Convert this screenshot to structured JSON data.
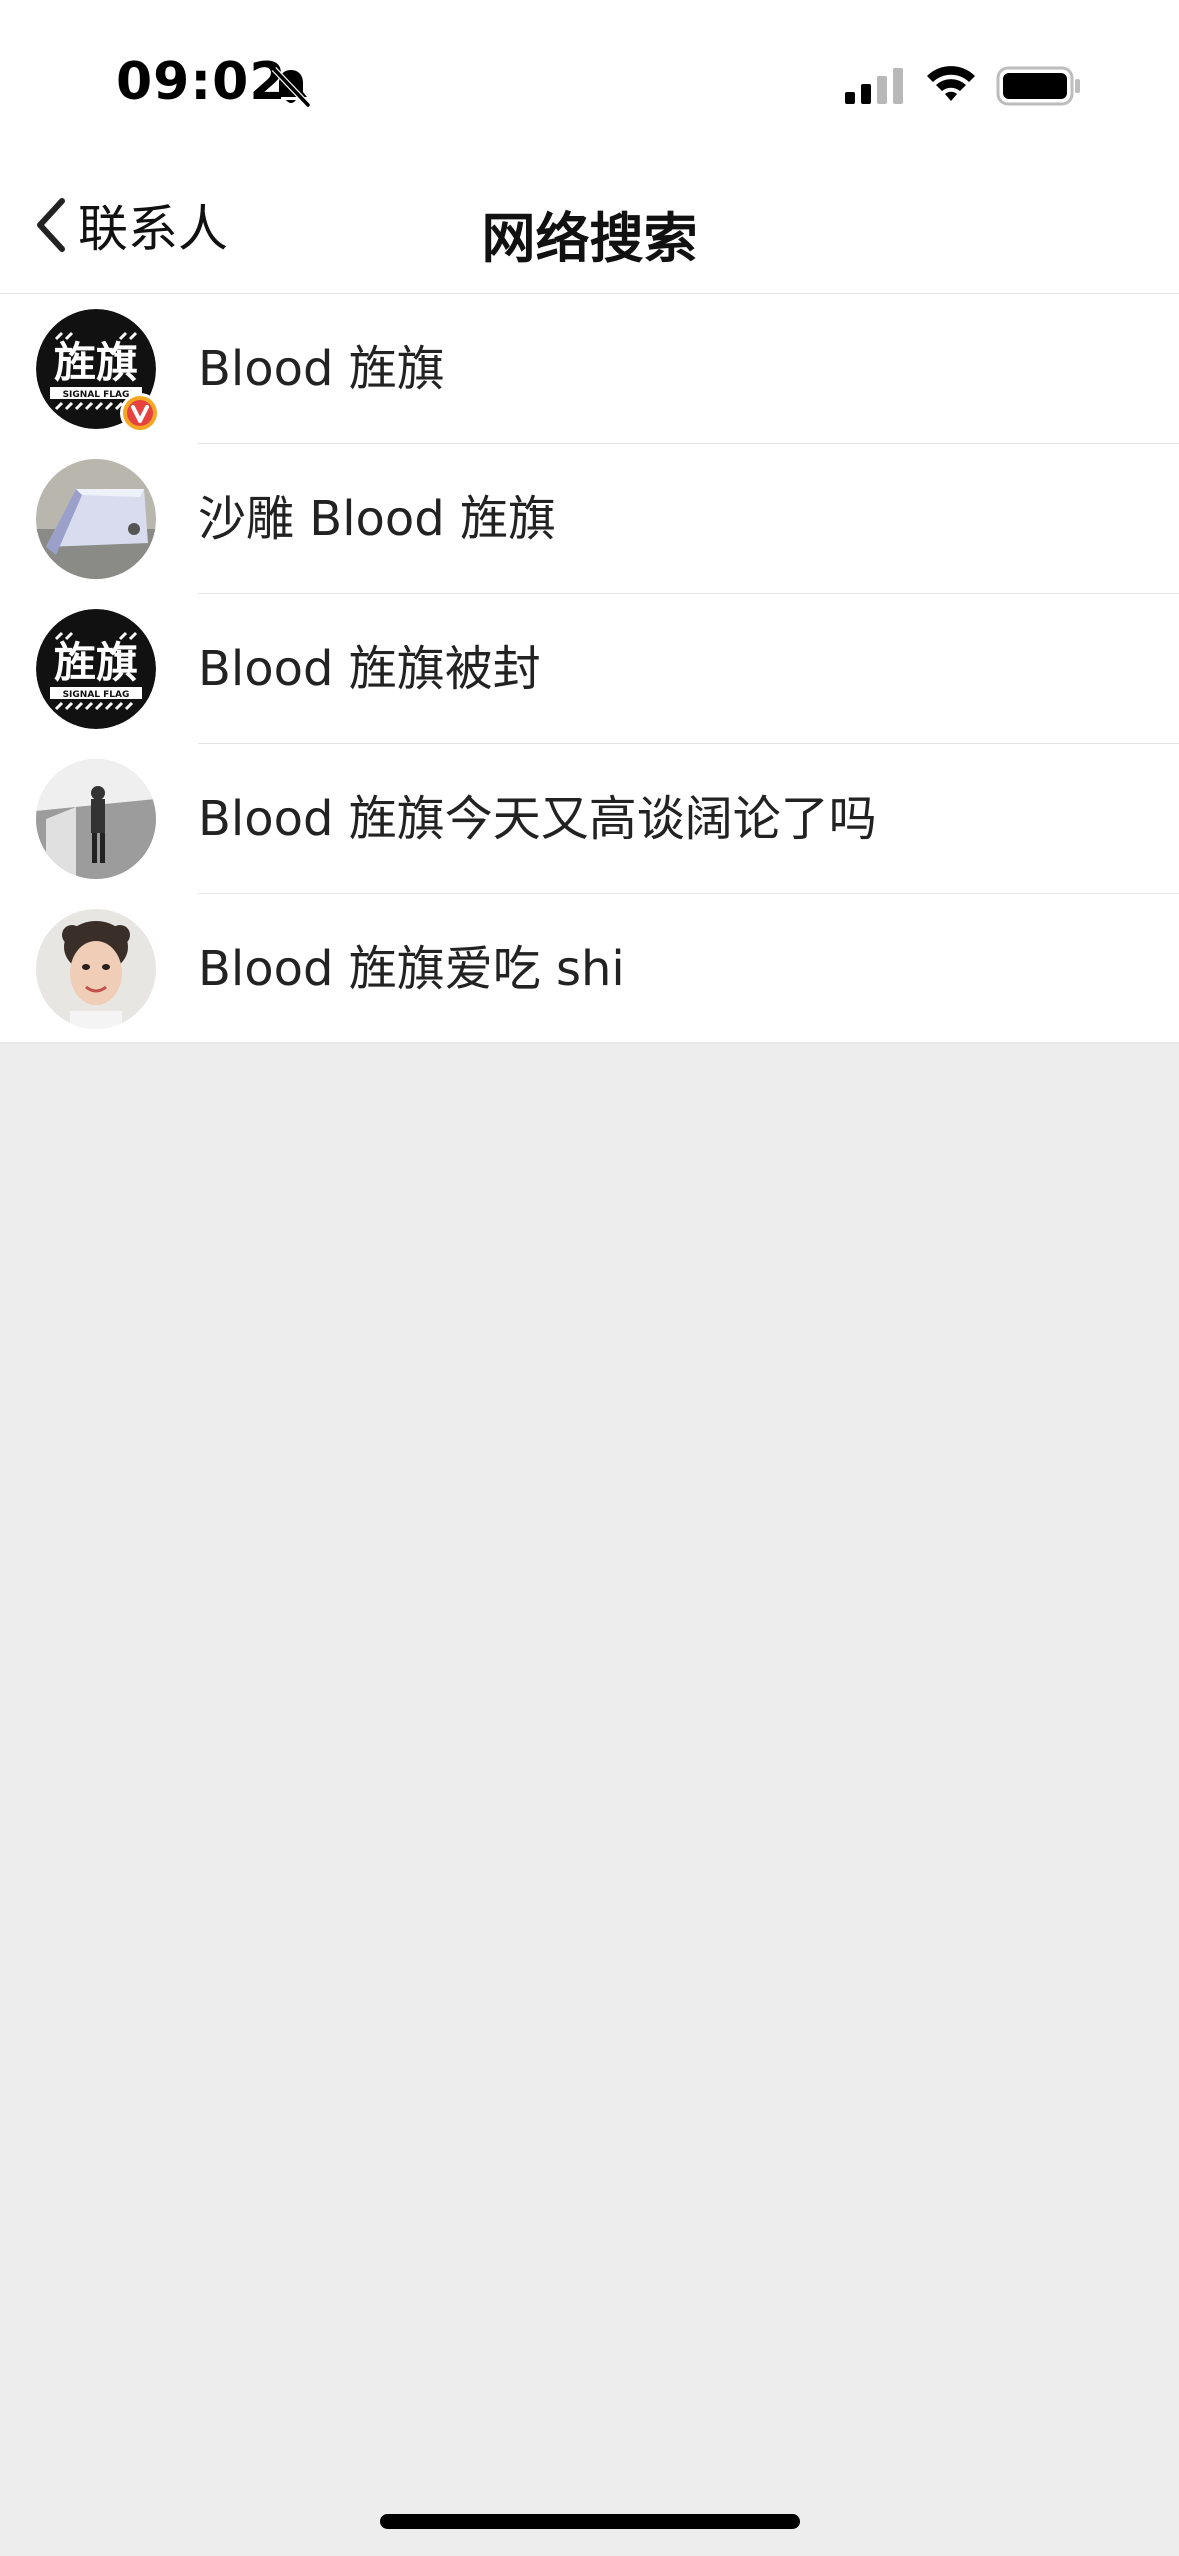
{
  "status_bar": {
    "time": "09:02",
    "icons": [
      "bell-muted-icon",
      "cellular-signal-icon",
      "wifi-icon",
      "battery-icon"
    ]
  },
  "nav": {
    "back_label": "联系人",
    "title": "网络搜索",
    "back_icon": "chevron-left-icon"
  },
  "results": [
    {
      "text": "Blood 旌旗",
      "avatar": "signal-flag-logo",
      "verified": true
    },
    {
      "text": "沙雕 Blood 旌旗",
      "avatar": "photo-folded-card"
    },
    {
      "text": "Blood 旌旗被封",
      "avatar": "signal-flag-logo"
    },
    {
      "text": "Blood 旌旗今天又高谈阔论了吗",
      "avatar": "photo-person-corridor"
    },
    {
      "text": "Blood 旌旗爱吃 shi",
      "avatar": "photo-woman-portrait"
    }
  ],
  "avatar_logo": {
    "text": "旌旗",
    "subtext": "SIGNAL FLAG"
  },
  "colors": {
    "background": "#ededed",
    "surface": "#ffffff",
    "text": "#222222",
    "badge": "#f5a623",
    "badge_inner": "#e64340"
  }
}
